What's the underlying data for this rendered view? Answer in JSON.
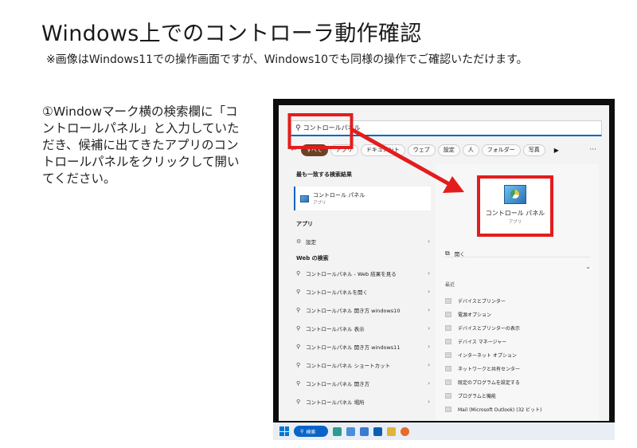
{
  "page": {
    "title": "Windows上でのコントローラ動作確認",
    "note": "※画像はWindows11での操作画面ですが、Windows10でも同様の操作でご確認いただけます。",
    "step": "①Windowマーク横の検索欄に「コントロールパネル」と入力していただき、候補に出てきたアプリのコントロールパネルをクリックして開いてください。"
  },
  "search": {
    "value": "コントロールパネル"
  },
  "chips": [
    "すべて",
    "アプリ",
    "ドキュメント",
    "ウェブ",
    "設定",
    "人",
    "フォルダー",
    "写真"
  ],
  "left": {
    "best_match_label": "最も一致する検索結果",
    "best_match": {
      "name": "コントロール パネル",
      "type": "アプリ"
    },
    "apps_label": "アプリ",
    "app_item": "設定",
    "web_label": "Web の検索",
    "web_items": [
      "コントロールパネル - Web 結果を見る",
      "コントロールパネルを開く",
      "コントロールパネル 開き方 windows10",
      "コントロールパネル 表示",
      "コントロールパネル 開き方 windows11",
      "コントロールパネル ショートカット",
      "コントロールパネル 開き方",
      "コントロールパネル 場所"
    ]
  },
  "right": {
    "app_name": "コントロール パネル",
    "app_type": "アプリ",
    "open_label": "開く",
    "recent_label": "最近",
    "recent_items": [
      "デバイスとプリンター",
      "電源オプション",
      "デバイスとプリンターの表示",
      "デバイス マネージャー",
      "インターネット オプション",
      "ネットワークと共有センター",
      "既定のプログラムを設定する",
      "プログラムと機能",
      "Mail (Microsoft Outlook) (32 ビット)"
    ]
  },
  "taskbar": {
    "search_label": "検索"
  },
  "colors": {
    "highlight": "#e31d1d",
    "accent": "#0067c0",
    "chip_active": "#6b4226"
  }
}
